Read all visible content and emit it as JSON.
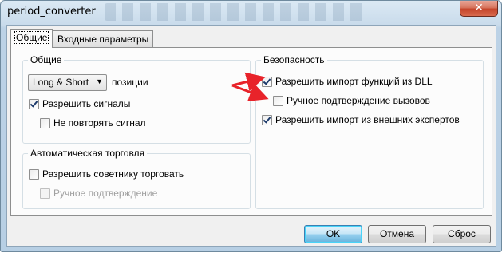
{
  "window": {
    "title": "period_converter",
    "close_glyph": "✕"
  },
  "tabs": [
    {
      "label": "Общие",
      "active": true
    },
    {
      "label": "Входные параметры",
      "active": false
    }
  ],
  "general": {
    "title": "Общие",
    "positions_select": "Long & Short",
    "positions_label": "позиции",
    "allow_signals": {
      "label": "Разрешить сигналы",
      "checked": true
    },
    "no_repeat_signal": {
      "label": "Не повторять сигнал",
      "checked": false
    }
  },
  "auto_trading": {
    "title": "Автоматическая торговля",
    "allow_ea": {
      "label": "Разрешить советнику торговать",
      "checked": false
    },
    "manual_confirm": {
      "label": "Ручное подтверждение",
      "checked": false,
      "disabled": true
    }
  },
  "security": {
    "title": "Безопасность",
    "allow_dll": {
      "label": "Разрешить импорт функций из DLL",
      "checked": true
    },
    "manual_calls": {
      "label": "Ручное подтверждение вызовов",
      "checked": false
    },
    "allow_external": {
      "label": "Разрешить импорт из внешних экспертов",
      "checked": true
    }
  },
  "buttons": {
    "ok": "OK",
    "cancel": "Отмена",
    "reset": "Сброс"
  },
  "colors": {
    "annotation_arrow": "#e8232a"
  }
}
